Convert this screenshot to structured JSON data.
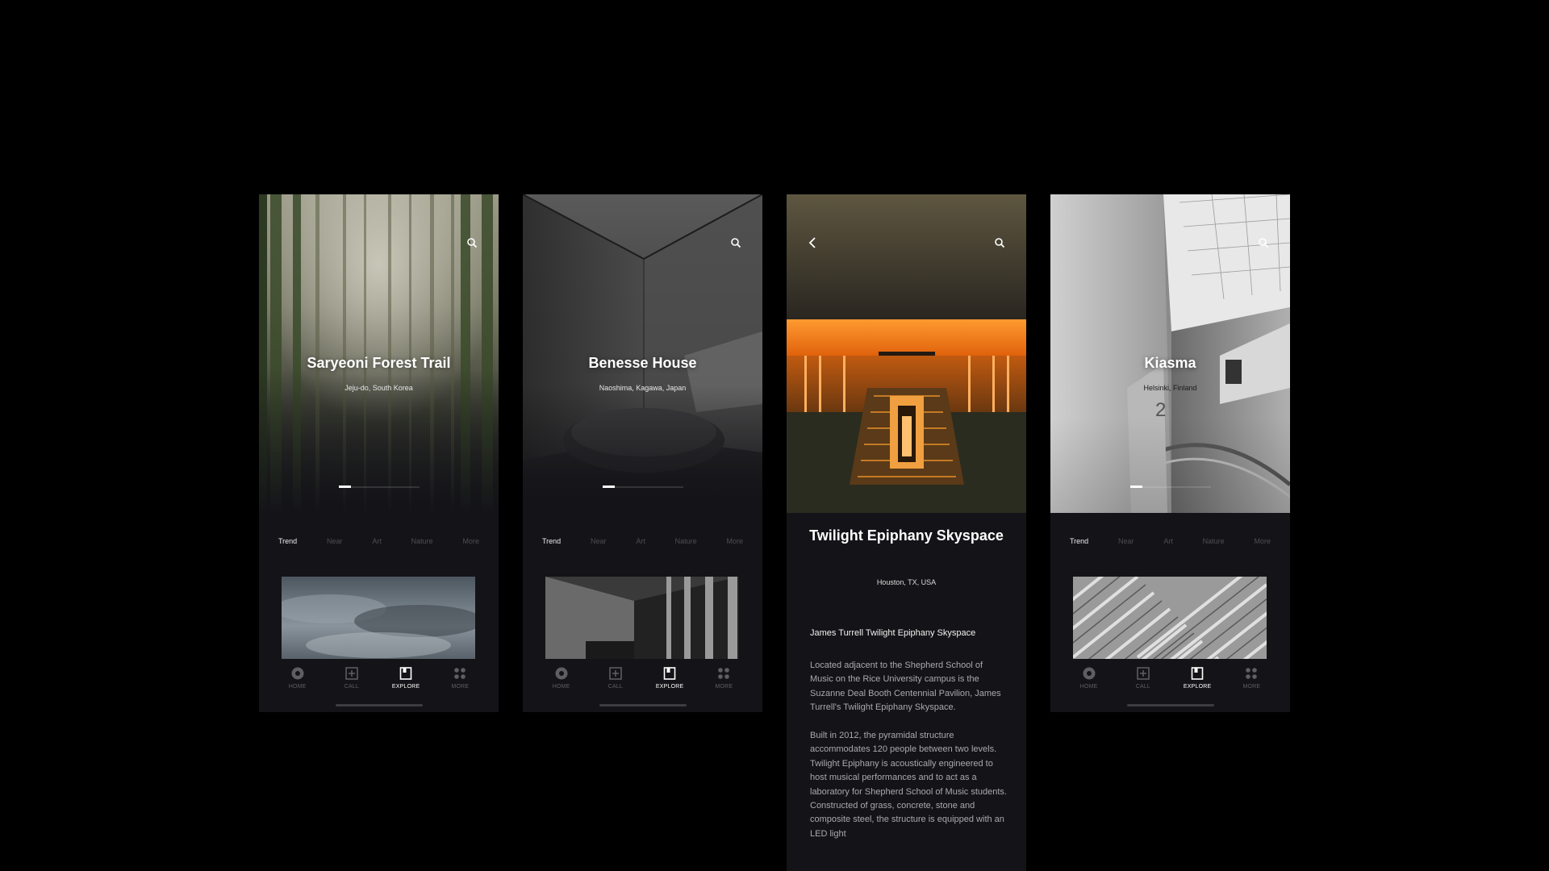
{
  "screens": [
    {
      "title": "Saryeoni Forest Trail",
      "location": "Jeju-do, South Korea",
      "categories": [
        "Trend",
        "Near",
        "Art",
        "Nature",
        "More"
      ],
      "active_category": "Trend",
      "carousel": {
        "current": 1
      }
    },
    {
      "title": "Benesse House",
      "location": "Naoshima, Kagawa, Japan",
      "categories": [
        "Trend",
        "Near",
        "Art",
        "Nature",
        "More"
      ],
      "active_category": "Trend",
      "carousel": {
        "current": 1
      }
    },
    {
      "title": "Twilight Epiphany Skyspace",
      "location": "Houston, TX, USA",
      "heading": "James Turrell Twilight Epiphany Skyspace",
      "paragraphs": [
        "Located adjacent to the Shepherd School of Music on the Rice University campus is the Suzanne Deal Booth Centennial Pavilion, James Turrell's Twilight Epiphany Skyspace.",
        "Built in 2012, the pyramidal structure accommodates 120 people between two levels. Twilight Epiphany is acoustically engineered to host musical performances and to act as a laboratory for Shepherd School of Music students. Constructed of grass, concrete, stone and composite steel, the structure is equipped with an LED light"
      ]
    },
    {
      "title": "Kiasma",
      "location": "Helsinki, Finland",
      "categories": [
        "Trend",
        "Near",
        "Art",
        "Nature",
        "More"
      ],
      "active_category": "Trend",
      "carousel": {
        "current": 1
      }
    }
  ],
  "nav": {
    "items": [
      {
        "label": "HOME",
        "icon": "home-icon"
      },
      {
        "label": "CALL",
        "icon": "call-icon"
      },
      {
        "label": "EXPLORE",
        "icon": "explore-icon"
      },
      {
        "label": "MORE",
        "icon": "more-icon"
      }
    ],
    "active": "EXPLORE"
  },
  "colors": {
    "background": "#000000",
    "screen_bg": "#141418",
    "accent_orange": "#f07a1a",
    "inactive_text": "#4c4c53",
    "active_text": "#ececec"
  }
}
